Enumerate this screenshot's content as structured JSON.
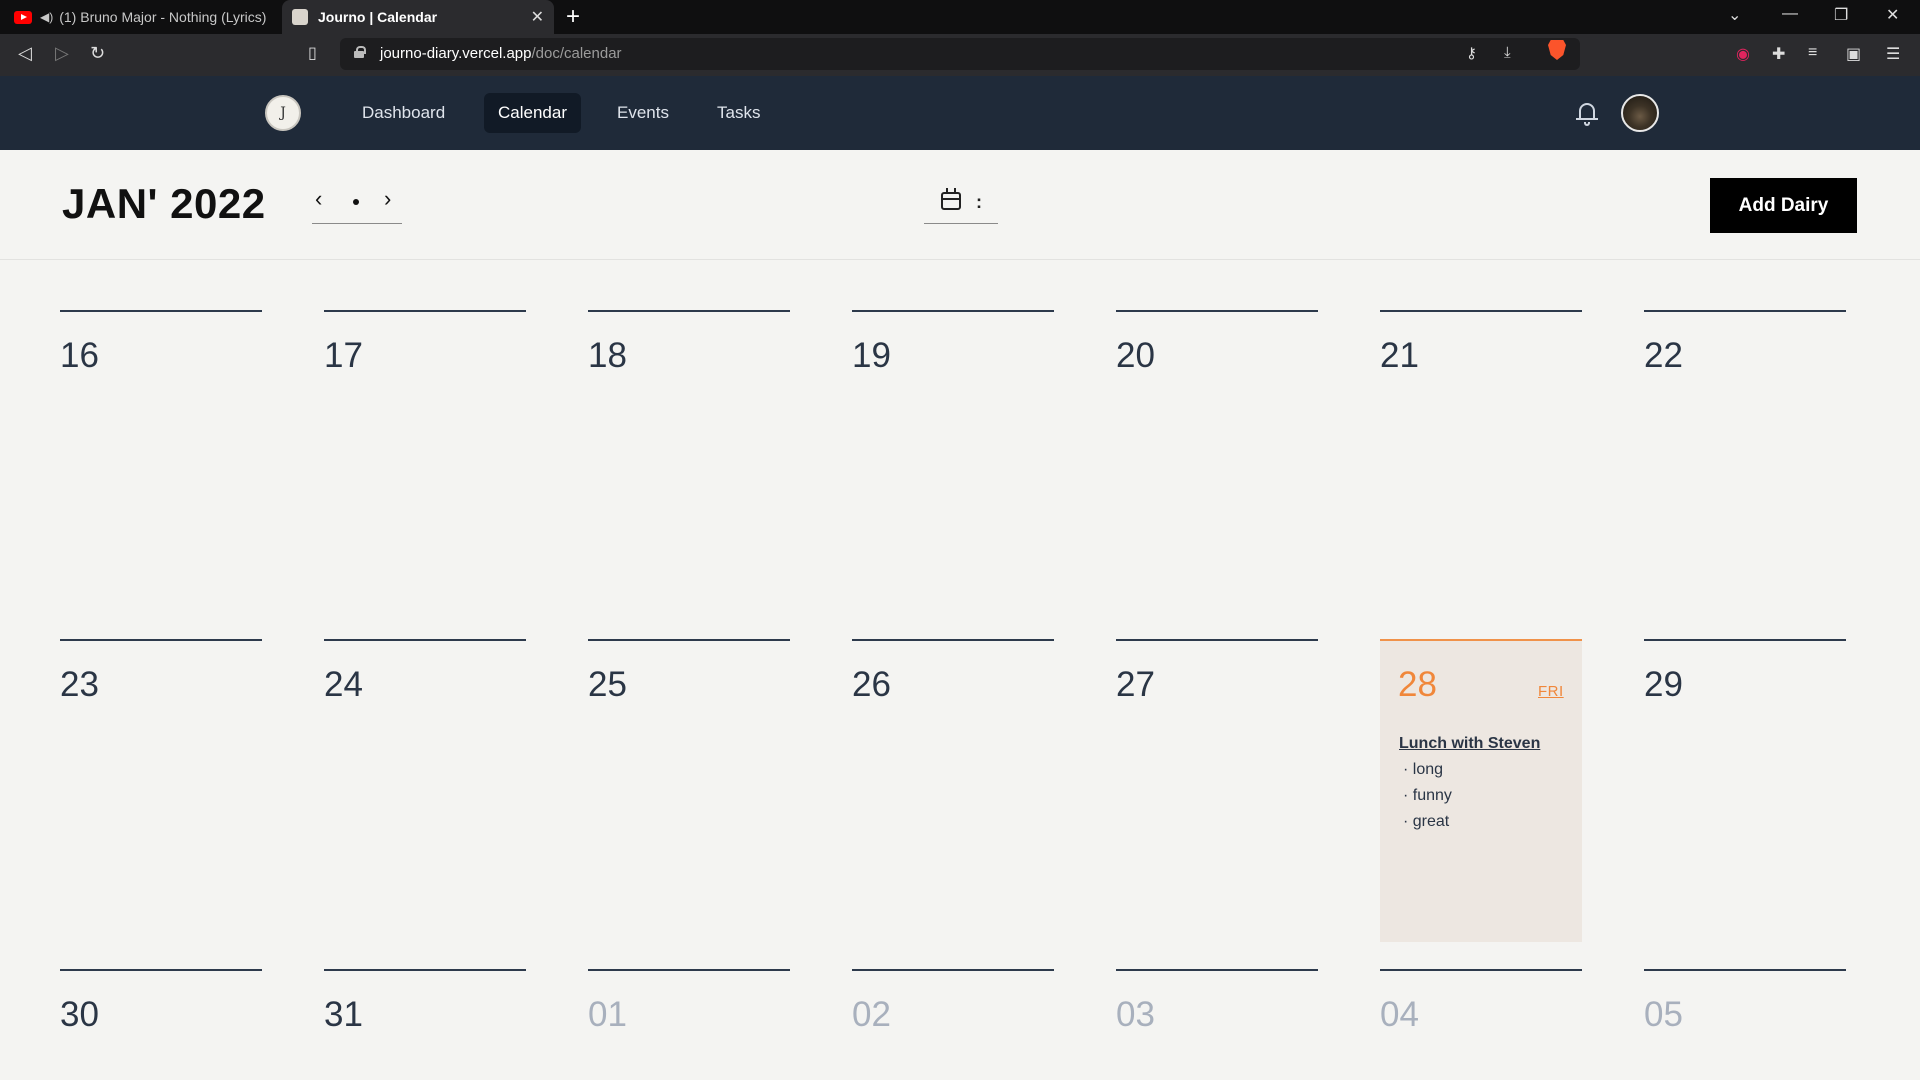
{
  "browser": {
    "tabs": [
      {
        "title": "(1) Bruno Major - Nothing (Lyrics)"
      },
      {
        "title": "Journo | Calendar"
      }
    ],
    "url_host": "journo-diary.vercel.app",
    "url_path": "/doc/calendar"
  },
  "app": {
    "nav": [
      "Dashboard",
      "Calendar",
      "Events",
      "Tasks"
    ],
    "active_nav": "Calendar"
  },
  "toolbar": {
    "month_label": "JAN' 2022",
    "add_button": "Add Dairy",
    "view_menu_glyph": ":"
  },
  "calendar": {
    "weeks": [
      [
        "16",
        "17",
        "18",
        "19",
        "20",
        "21",
        "22"
      ],
      [
        "23",
        "24",
        "25",
        "26",
        "27",
        "28",
        "29"
      ],
      [
        "30",
        "31",
        "01",
        "02",
        "03",
        "04",
        "05"
      ]
    ],
    "today": {
      "day": "28",
      "weekday": "FRI"
    },
    "event": {
      "title": "Lunch with Steven",
      "notes": [
        "· long",
        "· funny",
        "· great"
      ]
    }
  },
  "colors": {
    "header_bg": "#1f2a39",
    "accent": "#f0873a",
    "today_bg": "#ede7e1"
  }
}
